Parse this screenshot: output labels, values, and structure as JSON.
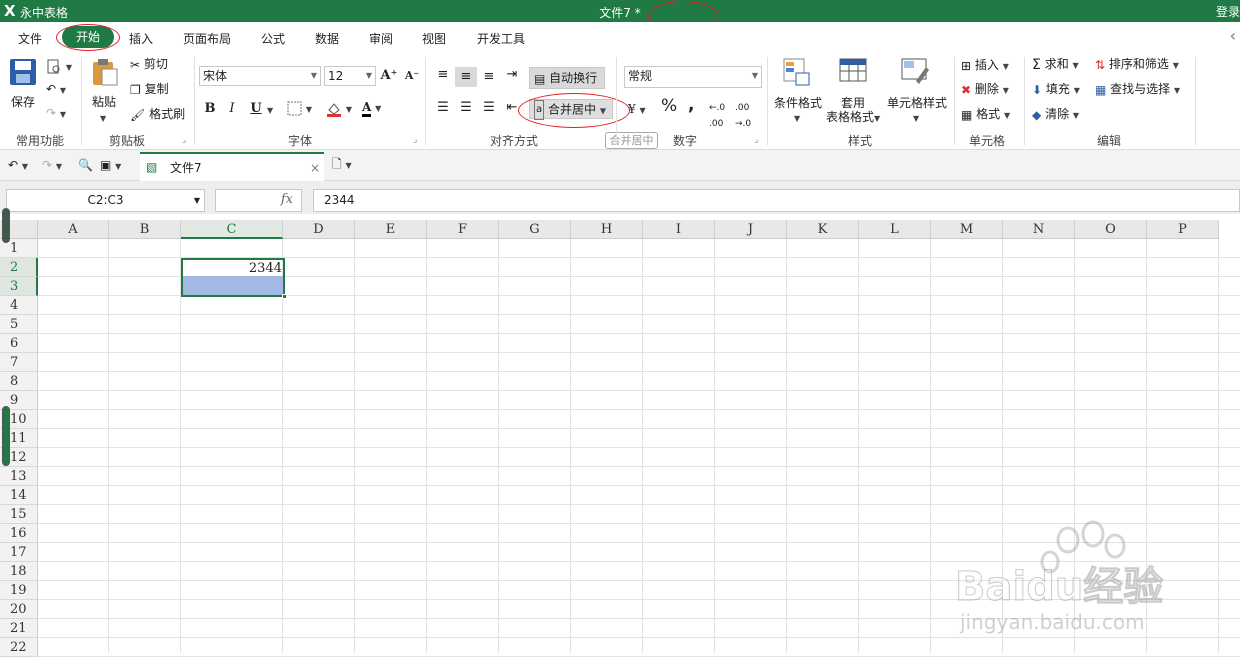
{
  "titlebar": {
    "app_logo": "Ⅹ",
    "app_name": "永中表格",
    "doc_title": "文件7 *",
    "login": "登录"
  },
  "menu": {
    "items": [
      "文件",
      "开始",
      "插入",
      "页面布局",
      "公式",
      "数据",
      "审阅",
      "视图",
      "开发工具"
    ]
  },
  "ribbon": {
    "common": {
      "save": "保存",
      "label": "常用功能"
    },
    "clipboard": {
      "paste": "粘贴",
      "cut": "剪切",
      "copy": "复制",
      "format_painter": "格式刷",
      "label": "剪贴板"
    },
    "font": {
      "name": "宋体",
      "size": "12",
      "bold": "B",
      "italic": "I",
      "underline": "U",
      "font_color_glyph": "A",
      "grow": "A⁺",
      "shrink": "A⁻",
      "label": "字体"
    },
    "alignment": {
      "wrap": "自动换行",
      "merge": "合并居中",
      "label": "对齐方式",
      "merge_tooltip": "合并居中"
    },
    "number": {
      "format": "常规",
      "percent": "%",
      "comma": ",",
      "currency": "¥",
      "inc_decimal": ".0→.00",
      "dec_decimal": ".00→.0",
      "label": "数字"
    },
    "styles": {
      "conditional": "条件格式",
      "table_format_1": "套用",
      "table_format_2": "表格格式",
      "cell_styles": "单元格样式",
      "label": "样式"
    },
    "cells": {
      "insert": "插入",
      "delete": "删除",
      "format": "格式",
      "label": "单元格"
    },
    "editing": {
      "sum": "求和",
      "sort": "排序和筛选",
      "fill": "填充",
      "find": "查找与选择",
      "clear": "清除",
      "label": "编辑"
    }
  },
  "doc_tab": {
    "name": "文件7"
  },
  "formula_bar": {
    "name_box": "C2:C3",
    "fx": "fx",
    "value": "2344"
  },
  "sheet": {
    "columns": [
      "A",
      "B",
      "C",
      "D",
      "E",
      "F",
      "G",
      "H",
      "I",
      "J",
      "K",
      "L",
      "M",
      "N",
      "O",
      "P"
    ],
    "rows": [
      "1",
      "2",
      "3",
      "4",
      "5",
      "6",
      "7",
      "8",
      "9",
      "10",
      "11",
      "12",
      "13",
      "14",
      "15",
      "16",
      "17",
      "18",
      "19",
      "20",
      "21",
      "22"
    ],
    "selected_column": "C",
    "selected_rows": [
      "2",
      "3"
    ],
    "cells": {
      "C2": "2344"
    }
  },
  "watermark": {
    "brand": "Baidu经验",
    "url": "jingyan.baidu.com"
  },
  "colors": {
    "accent": "#1f7a45",
    "selection_fill": "#a4b8e4",
    "annotation_red": "#dd2222"
  }
}
